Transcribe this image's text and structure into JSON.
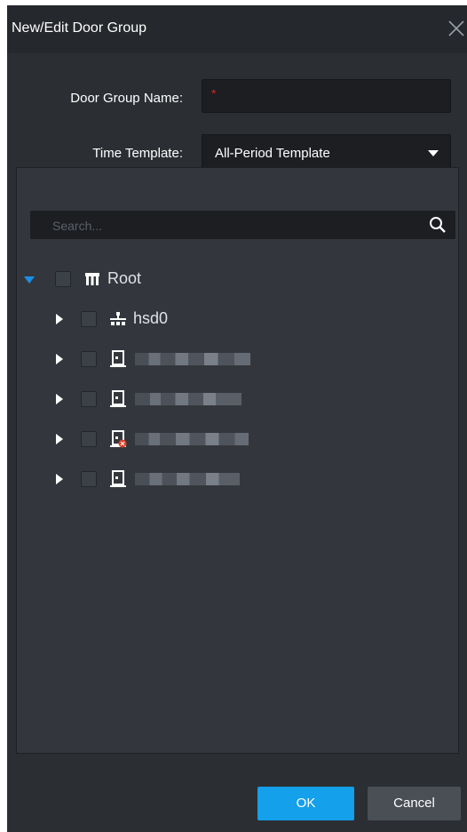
{
  "dialog": {
    "title": "New/Edit Door Group",
    "close_icon": "close-icon"
  },
  "form": {
    "name_label": "Door Group Name:",
    "name_value": "",
    "required_mark": "*",
    "template_label": "Time Template:",
    "template_value": "All-Period Template"
  },
  "search": {
    "placeholder": "Search..."
  },
  "tree": {
    "root_label": "Root",
    "items": [
      {
        "label": "hsd0",
        "icon": "network-icon"
      },
      {
        "label": "",
        "icon": "door-device-icon"
      },
      {
        "label": "",
        "icon": "door-device-icon"
      },
      {
        "label": "",
        "icon": "door-device-offline-icon"
      },
      {
        "label": "",
        "icon": "door-device-icon"
      }
    ]
  },
  "buttons": {
    "ok": "OK",
    "cancel": "Cancel"
  },
  "colors": {
    "accent": "#14a0ea",
    "dialog_bg": "#2b2e33",
    "tree_bg": "#33373d",
    "alert": "#e0402a"
  }
}
